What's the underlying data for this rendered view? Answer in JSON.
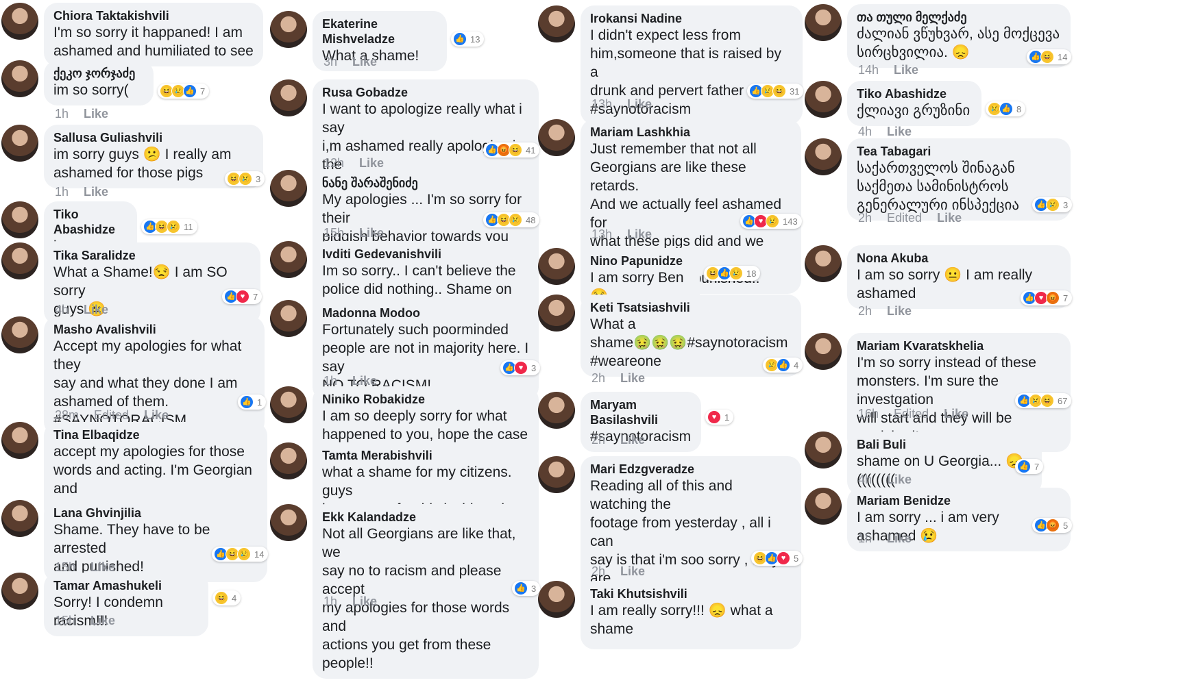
{
  "columns": [
    [
      {
        "name": "Chiora Taktakishvili",
        "text": "I'm so sorry it happaned! I am\nashamed and humiliated to see",
        "time": "",
        "edited": "",
        "like": "",
        "reactions": [],
        "count": ""
      },
      {
        "name": "ქეკო ჯორჯაძე",
        "text": "im so sorry(",
        "time": "1h",
        "edited": "",
        "like": "Like",
        "reactions": [
          "haha",
          "sad",
          "like"
        ],
        "count": "7"
      },
      {
        "name": "Sallusa Guliashvili",
        "text": "im sorry guys 😕 I really am\nashamed for those pigs",
        "time": "1h",
        "edited": "",
        "like": "Like",
        "reactions": [
          "haha",
          "sad"
        ],
        "count": "3"
      },
      {
        "name": "Tiko Abashidze",
        "text": "i am sorry 😞",
        "time": "",
        "edited": "",
        "like": "",
        "reactions": [
          "like",
          "haha",
          "sad"
        ],
        "count": "11"
      },
      {
        "name": "Tika Saralidze",
        "text": "What a Shame!😒 I am SO sorry\nguys 😐",
        "time": "4h",
        "edited": "",
        "like": "Like",
        "reactions": [
          "like",
          "love"
        ],
        "count": "7"
      },
      {
        "name": "Masho Avalishvili",
        "text": "Accept my apologies for what they\nsay and what they done I am\nashamed of them.\n#SAYNOTORACISM",
        "time": "28m",
        "edited": "Edited",
        "like": "Like",
        "reactions": [
          "like"
        ],
        "count": "1"
      },
      {
        "name": "Tina Elbaqidze",
        "text": "accept my apologies for those\nwords and acting. I'm Georgian and\nI feel ashamed",
        "time": "",
        "edited": "",
        "like": "",
        "reactions": [],
        "count": ""
      },
      {
        "name": "Lana Ghvinjilia",
        "text": "Shame. They have to be arrested\nand punished!",
        "time": "15h",
        "edited": "",
        "like": "Like",
        "reactions": [
          "like",
          "haha",
          "sad"
        ],
        "count": "14"
      },
      {
        "name": "Tamar Amashukeli",
        "text": "Sorry! I condemn racism!!!",
        "time": "15h",
        "edited": "",
        "like": "Like",
        "reactions": [
          "haha"
        ],
        "count": "4"
      }
    ],
    [
      {
        "name": "Ekaterine Mishveladze",
        "text": "What a shame!",
        "time": "3h",
        "edited": "",
        "like": "Like",
        "reactions": [
          "like"
        ],
        "count": "13"
      },
      {
        "name": "Rusa Gobadze",
        "text": "I want to apologize really what i say\ni,m ashamed really apologize in the\nname of georgians 😞",
        "time": "12h",
        "edited": "",
        "like": "Like",
        "reactions": [
          "like",
          "angry",
          "haha"
        ],
        "count": "41"
      },
      {
        "name": "ნანე შარაშენიძე",
        "text": "My apologies ... I'm so sorry for their\npiggish behavior towards you guys.",
        "time": "15h",
        "edited": "",
        "like": "Like",
        "reactions": [
          "like",
          "haha",
          "sad"
        ],
        "count": "48"
      },
      {
        "name": "Ivditi Gedevanishvili",
        "text": "Im so sorry.. I can't believe the\npolice did nothing.. Shame on our",
        "time": "",
        "edited": "",
        "like": "",
        "reactions": [],
        "count": ""
      },
      {
        "name": "Madonna Modoo",
        "text": "Fortunately such poorminded\npeople are not in majority here. I say\nNO TO RACISM!",
        "time": "1h",
        "edited": "",
        "like": "Like",
        "reactions": [
          "like",
          "love"
        ],
        "count": "3"
      },
      {
        "name": "Niniko Robakidze",
        "text": "I am so deeply sorry for what\nhappened to you, hope the case will",
        "time": "",
        "edited": "",
        "like": "",
        "reactions": [],
        "count": ""
      },
      {
        "name": "Tamta Merabishvili",
        "text": "what a shame for my citizens. guys\nim so sorry for this incident. its not",
        "time": "",
        "edited": "",
        "like": "",
        "reactions": [],
        "count": ""
      },
      {
        "name": "Ekk Kalandadze",
        "text": "Not all Georgians are like that, we\nsay no to racism and please accept\nmy apologies for those words and\nactions you get from these people!!",
        "time": "1h",
        "edited": "",
        "like": "Like",
        "reactions": [
          "like"
        ],
        "count": "3"
      }
    ],
    [
      {
        "name": "Irokansi Nadine",
        "text": "I didn't expect less from\nhim,someone that is raised by a\ndrunk and pervert father\n#saynotoracism",
        "time": "13h",
        "edited": "",
        "like": "Like",
        "reactions": [
          "like",
          "sad",
          "haha"
        ],
        "count": "31"
      },
      {
        "name": "Mariam Lashkhia",
        "text": "Just remember that not all\nGeorgians are like these retards.\nAnd we actually feel ashamed for\nwhat these pigs did and we hope\nthat they will be punished..",
        "time": "13h",
        "edited": "",
        "like": "Like",
        "reactions": [
          "like",
          "love",
          "sad"
        ],
        "count": "143"
      },
      {
        "name": "Nino Papunidze",
        "text": "I am sorry Ben 😢",
        "time": "",
        "edited": "",
        "like": "",
        "reactions": [
          "haha",
          "like",
          "sad"
        ],
        "count": "18"
      },
      {
        "name": "Keti Tsatsiashvili",
        "text": "What a\nshame🤢🤢🤢#saynotoracism\n#weareone",
        "time": "2h",
        "edited": "",
        "like": "Like",
        "reactions": [
          "sad",
          "like"
        ],
        "count": "4"
      },
      {
        "name": "Maryam Basilashvili",
        "text": "#saynotoracism",
        "time": "2h",
        "edited": "",
        "like": "Like",
        "reactions": [
          "love"
        ],
        "count": "1"
      },
      {
        "name": "Mari Edzgveradze",
        "text": "Reading all of this and watching the\nfootage from yesterday , all i can\nsay is that i'm soo sorry , they are\nthe real shame and disappointment\nof our country 😶😶✋✋",
        "time": "2h",
        "edited": "",
        "like": "Like",
        "reactions": [
          "haha",
          "like",
          "love"
        ],
        "count": "5"
      },
      {
        "name": "Taki Khutsishvili",
        "text": "I am really sorry!!! 😞 what a shame",
        "time": "",
        "edited": "",
        "like": "",
        "reactions": [],
        "count": ""
      }
    ],
    [
      {
        "name": "თა თული მელქაძე",
        "text": "ძალიან ვწუხვარ, ასე მოქცევა\nსირცხვილია. 😞",
        "time": "14h",
        "edited": "",
        "like": "Like",
        "reactions": [
          "like",
          "haha"
        ],
        "count": "14"
      },
      {
        "name": "Tiko Abashidze",
        "text": "ქლიავი გრუზინი",
        "time": "4h",
        "edited": "",
        "like": "Like",
        "reactions": [
          "sad",
          "like"
        ],
        "count": "8"
      },
      {
        "name": "Tea Tabagari",
        "text": "საქართველოს შინაგან\nსაქმეთა სამინისტროს\nგენერალური ინსპექცია",
        "time": "2h",
        "edited": "Edited",
        "like": "Like",
        "reactions": [
          "like",
          "sad"
        ],
        "count": "3"
      },
      {
        "name": "Nona Akuba",
        "text": "I am so sorry 😐 I am really\nashamed",
        "time": "2h",
        "edited": "",
        "like": "Like",
        "reactions": [
          "like",
          "love",
          "angry"
        ],
        "count": "7"
      },
      {
        "name": "Mariam Kvaratskhelia",
        "text": "I'm so sorry instead of these\nmonsters. I'm sure the investgation\nwill start and they will be punished!",
        "time": "16h",
        "edited": "Edited",
        "like": "Like",
        "reactions": [
          "like",
          "sad",
          "haha"
        ],
        "count": "67"
      },
      {
        "name": "Bali Buli",
        "text": "shame on U Georgia... 😞((((((((",
        "time": "4h",
        "edited": "",
        "like": "Like",
        "reactions": [
          "like"
        ],
        "count": "7"
      },
      {
        "name": "Mariam Benidze",
        "text": "I am sorry ... i am very ashamed 😢",
        "time": "1h",
        "edited": "",
        "like": "Like",
        "reactions": [
          "like",
          "angry"
        ],
        "count": "5"
      }
    ]
  ]
}
